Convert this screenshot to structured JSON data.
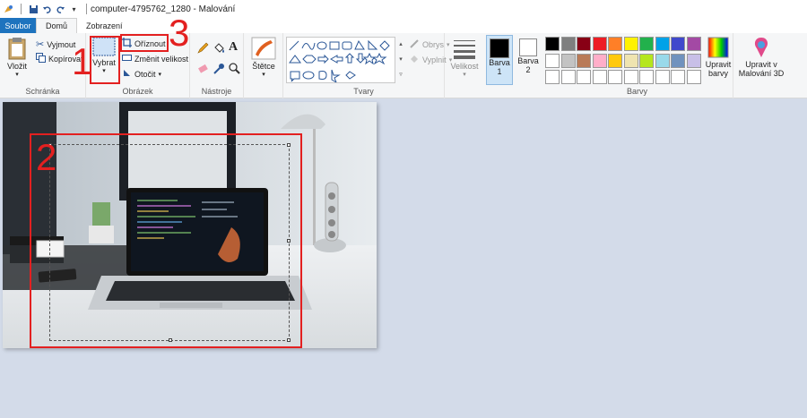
{
  "window": {
    "title": "computer-4795762_1280 - Malování"
  },
  "tabs": [
    {
      "label": "Soubor"
    },
    {
      "label": "Domů"
    },
    {
      "label": "Zobrazení"
    }
  ],
  "groups": {
    "clipboard": {
      "label": "Schránka",
      "paste": "Vložit",
      "cut": "Vyjmout",
      "copy": "Kopírovat"
    },
    "image": {
      "label": "Obrázek",
      "select": "Vybrat",
      "crop": "Oříznout",
      "resize": "Změnit velikost",
      "rotate": "Otočit"
    },
    "tools": {
      "label": "Nástroje"
    },
    "brushes": {
      "label": "Štětce"
    },
    "shapes": {
      "label": "Tvary",
      "outline": "Obrys",
      "fill": "Vyplnit"
    },
    "size": {
      "label": "Velikost"
    },
    "color1": {
      "label": "Barva",
      "num": "1"
    },
    "color2": {
      "label": "Barva",
      "num": "2"
    },
    "colors": {
      "label": "Barvy",
      "edit": "Upravit barvy",
      "paint3d": "Upravit v Malování 3D"
    }
  },
  "palette_row1": [
    "#000000",
    "#7f7f7f",
    "#880015",
    "#ed1c24",
    "#ff7f27",
    "#fff200",
    "#22b14c",
    "#00a2e8",
    "#3f48cc",
    "#a349a4"
  ],
  "palette_row2": [
    "#ffffff",
    "#c3c3c3",
    "#b97a57",
    "#ffaec9",
    "#ffc90e",
    "#efe4b0",
    "#b5e61d",
    "#99d9ea",
    "#7092be",
    "#c8bfe7"
  ],
  "annotations": {
    "n1": "1",
    "n2": "2",
    "n3": "3"
  },
  "accent": "#e32020"
}
